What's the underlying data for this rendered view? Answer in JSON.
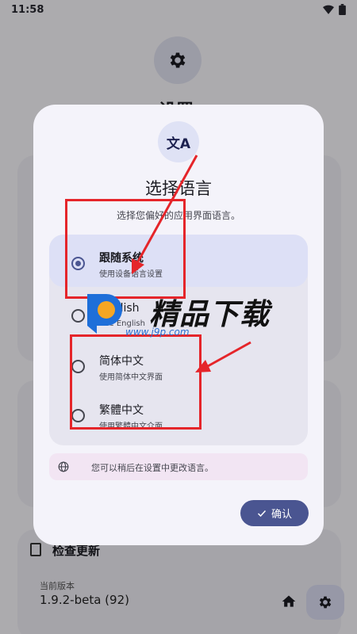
{
  "status_bar": {
    "time": "11:58"
  },
  "background": {
    "title": "设置",
    "update_card": {
      "title": "检查更新",
      "version_label": "当前版本",
      "version_value": "1.9.2-beta (92)"
    }
  },
  "dialog": {
    "icon": "translate-icon",
    "icon_glyph": "文A",
    "title": "选择语言",
    "subtitle": "选择您偏好的应用界面语言。",
    "options": [
      {
        "label": "跟随系统",
        "desc": "使用设备语言设置",
        "selected": true
      },
      {
        "label": "English",
        "desc": "Use English",
        "selected": false
      },
      {
        "label": "简体中文",
        "desc": "使用简体中文界面",
        "selected": false
      },
      {
        "label": "繁體中文",
        "desc": "使用繁體中文介面",
        "selected": false
      }
    ],
    "tip": "您可以稍后在设置中更改语言。",
    "confirm_label": "确认"
  },
  "watermark": {
    "title": "精品下载",
    "url": "www.j9p.com"
  },
  "colors": {
    "accent": "#4a5591",
    "annotation_red": "#e5252a",
    "selected_bg": "#dde0f6",
    "tip_bg": "#f2e5f3"
  }
}
